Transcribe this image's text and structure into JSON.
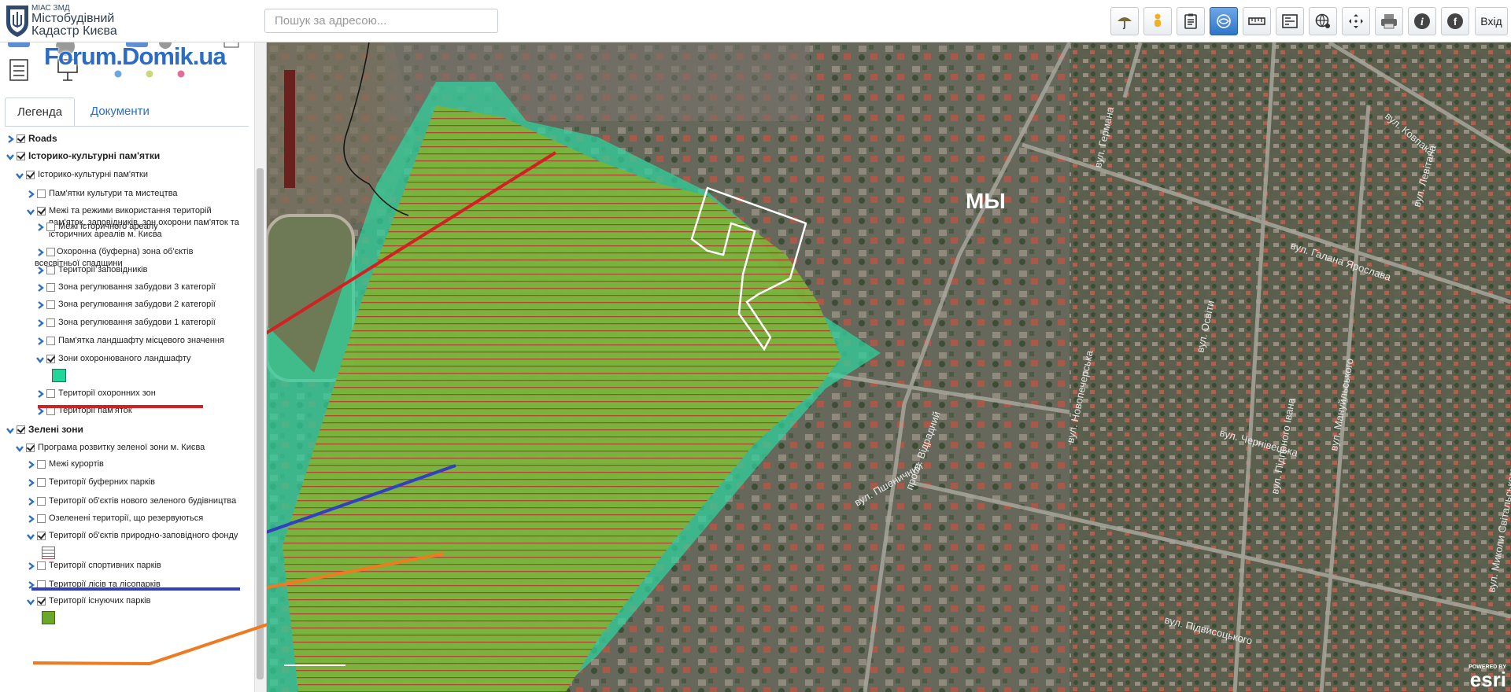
{
  "header": {
    "brand_small": "МІАС ЗМД",
    "brand_line1": "Містобудівний",
    "brand_line2": "Кадастр Києва",
    "search_placeholder": "Пошук за адресою...",
    "login_label": "Вхід",
    "toolbar": [
      "umbrella-icon",
      "person-icon",
      "clipboard-icon",
      "globe-swirl-icon",
      "ruler-icon",
      "print-layout-icon",
      "world-settings-icon",
      "move-arrows-icon",
      "printer-icon",
      "info-icon",
      "facebook-icon"
    ]
  },
  "sidebar": {
    "watermark": "Forum.Domik.ua",
    "tabs": [
      {
        "label": "Легенда",
        "active": true
      },
      {
        "label": "Документи",
        "active": false
      }
    ],
    "tree": [
      {
        "label": "Roads",
        "level": 0,
        "checked": true,
        "expanded": false,
        "bold": true
      },
      {
        "label": "Історико-культурні пам'ятки",
        "level": 0,
        "checked": true,
        "expanded": true,
        "bold": true
      },
      {
        "label": "Історико-культурні пам'ятки",
        "level": 1,
        "checked": true,
        "expanded": true
      },
      {
        "label": "Пам'ятки культури та мистецтва",
        "level": 2,
        "checked": false,
        "expanded": false
      },
      {
        "label": "Межі та режими використання територій пам'яток, заповідників, зон охорони пам'яток та історичних ареалів м. Києва",
        "level": 2,
        "checked": true,
        "expanded": true
      },
      {
        "label": "Межі історичного ареалу",
        "level": 3,
        "checked": false,
        "expanded": false
      },
      {
        "label": "Охоронна (буферна) зона об'єктів всесвітньої спадщини",
        "level": 3,
        "checked": false,
        "expanded": false
      },
      {
        "label": "Території заповідників",
        "level": 3,
        "checked": false,
        "expanded": false
      },
      {
        "label": "Зона регулювання забудови 3 категорії",
        "level": 3,
        "checked": false,
        "expanded": false
      },
      {
        "label": "Зона регулювання забудови 2 категорії",
        "level": 3,
        "checked": false,
        "expanded": false
      },
      {
        "label": "Зона регулювання забудови 1 категорії",
        "level": 3,
        "checked": false,
        "expanded": false
      },
      {
        "label": "Пам'ятка ландшафту місцевого значення",
        "level": 3,
        "checked": false,
        "expanded": false
      },
      {
        "label": "Зони охоронюваного ландшафту",
        "level": 3,
        "checked": true,
        "expanded": true
      },
      {
        "label": "Території охоронних зон",
        "level": 3,
        "checked": false,
        "expanded": false
      },
      {
        "label": "Території пам'яток",
        "level": 3,
        "checked": false,
        "expanded": false
      },
      {
        "label": "Зелені зони",
        "level": 0,
        "checked": true,
        "expanded": true,
        "bold": true
      },
      {
        "label": "Програма розвитку зеленої зони м. Києва",
        "level": 1,
        "checked": true,
        "expanded": true
      },
      {
        "label": "Межі курортів",
        "level": 2,
        "checked": false,
        "expanded": false
      },
      {
        "label": "Території буферних парків",
        "level": 2,
        "checked": false,
        "expanded": false
      },
      {
        "label": "Території об'єктів нового зеленого будівництва",
        "level": 2,
        "checked": false,
        "expanded": false
      },
      {
        "label": "Озеленені території, що резервуються",
        "level": 2,
        "checked": false,
        "expanded": false
      },
      {
        "label": "Території об'єктів природно-заповідного фонду",
        "level": 2,
        "checked": true,
        "expanded": true
      },
      {
        "label": "Території спортивних парків",
        "level": 2,
        "checked": false,
        "expanded": false
      },
      {
        "label": "Території лісів та лісопарків",
        "level": 2,
        "checked": false,
        "expanded": false
      },
      {
        "label": "Території існуючих парків",
        "level": 2,
        "checked": true,
        "expanded": true
      }
    ],
    "swatch_colors": {
      "landscape": "#22d69a",
      "reserve": "#c05050",
      "parks": "#6aa82a"
    }
  },
  "map": {
    "annotation": "МЫ",
    "streets": [
      "вул. Галана Ярослава",
      "вул. Чернівецька",
      "вул. Підвисоцького",
      "просп. Відрадний",
      "вул. Пшеничний",
      "вул. Германа",
      "вул. Ковпака",
      "вул. Левітана",
      "вул. Мануйльського",
      "вул. Новопечерська",
      "вул. Підгірного Івана",
      "вул. Освіти",
      "вул. Миколи Світальського"
    ],
    "esri_small": "POWERED BY",
    "esri_big": "esri",
    "colors": {
      "zone_fill": "#33d0a0",
      "park_fill": "#7fb23a",
      "park_stroke": "#c0392b",
      "red_line": "#d42020",
      "blue_line": "#3040c0",
      "orange_line": "#f07a20",
      "outline": "#ffffff"
    }
  }
}
